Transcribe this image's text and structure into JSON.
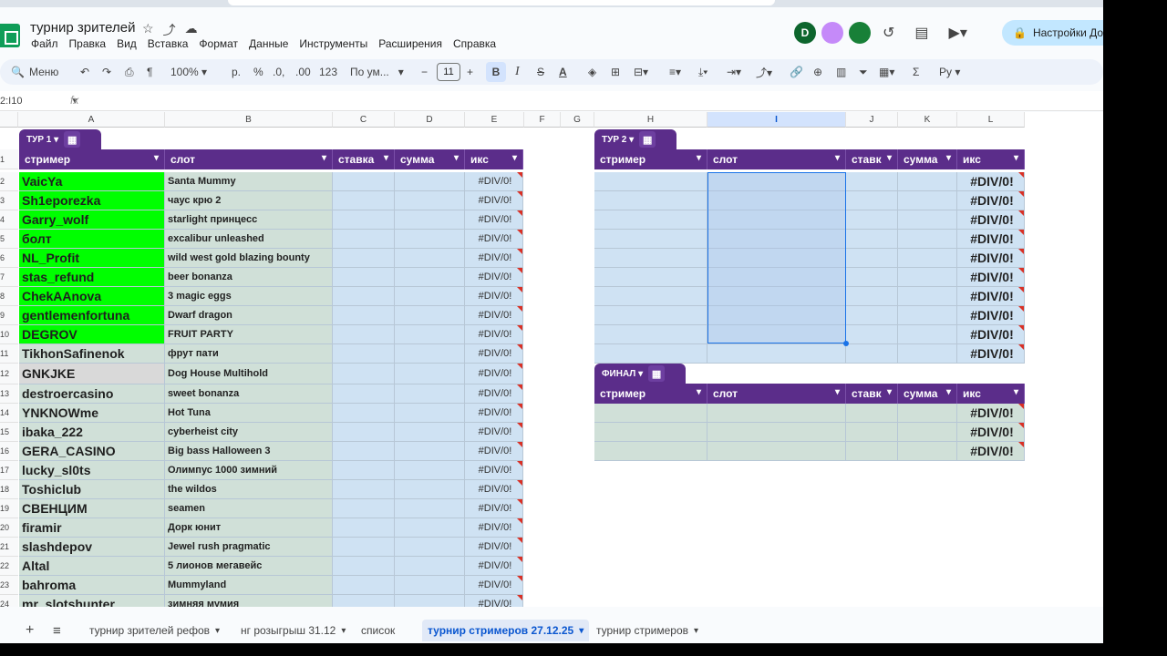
{
  "doc": {
    "title": "турнир зрителей"
  },
  "menu": [
    "Файл",
    "Правка",
    "Вид",
    "Вставка",
    "Формат",
    "Данные",
    "Инструменты",
    "Расширения",
    "Справка"
  ],
  "avatars": [
    {
      "letter": "D",
      "color": "#0d652d"
    },
    {
      "letter": "",
      "color": "#c58af9"
    },
    {
      "letter": "",
      "color": "#188038"
    }
  ],
  "share_label": "Настройки Дос",
  "toolbar": {
    "menu_search": "Меню",
    "zoom": "100%",
    "currency": "р.",
    "percent": "%",
    "dec_minus": ".0,",
    "dec_plus": ".00",
    "numfmt": "123",
    "font": "По ум...",
    "font_size": "11",
    "bold": "B",
    "italic": "I",
    "strike": "S",
    "textcolor": "A",
    "sum": "Σ",
    "input_lang": "Ру"
  },
  "namebox": "2:I10",
  "fx": "fx",
  "columns": [
    "A",
    "B",
    "C",
    "D",
    "E",
    "F",
    "G",
    "H",
    "I",
    "J",
    "K",
    "L"
  ],
  "tour1": {
    "tab_label": "ТУР 1",
    "headers": [
      "стример",
      "слот",
      "ставка",
      "сумма",
      "икс"
    ],
    "rows": [
      {
        "num": "2",
        "streamer": "VaicYa",
        "slot": "Santa Mummy",
        "x": "#DIV/0!",
        "hl": "green"
      },
      {
        "num": "3",
        "streamer": "Sh1eporezka",
        "slot": "чаус крю 2",
        "x": "#DIV/0!",
        "hl": "green"
      },
      {
        "num": "4",
        "streamer": "Garry_wolf",
        "slot": "starlight принцесс",
        "x": "#DIV/0!",
        "hl": "green"
      },
      {
        "num": "5",
        "streamer": "болт",
        "slot": "excalibur unleashed",
        "x": "#DIV/0!",
        "hl": "green"
      },
      {
        "num": "6",
        "streamer": "NL_Profit",
        "slot": "wild west gold blazing bounty",
        "x": "#DIV/0!",
        "hl": "green"
      },
      {
        "num": "7",
        "streamer": "stas_refund",
        "slot": "beer bonanza",
        "x": "#DIV/0!",
        "hl": "green"
      },
      {
        "num": "8",
        "streamer": "ChekAAnova",
        "slot": "3 magic eggs",
        "x": "#DIV/0!",
        "hl": "green"
      },
      {
        "num": "9",
        "streamer": "gentlemenfortuna",
        "slot": "Dwarf dragon",
        "x": "#DIV/0!",
        "hl": "green"
      },
      {
        "num": "10",
        "streamer": "DEGROV",
        "slot": "FRUIT PARTY",
        "x": "#DIV/0!",
        "hl": "green"
      },
      {
        "num": "11",
        "streamer": "TikhonSafinenok",
        "slot": "фрут пати",
        "x": "#DIV/0!",
        "hl": ""
      },
      {
        "num": "12",
        "streamer": "GNKJKE",
        "slot": "Dog House Multihold",
        "x": "#DIV/0!",
        "hl": "grey"
      },
      {
        "num": "13",
        "streamer": "destroercasino",
        "slot": "sweet bonanza",
        "x": "#DIV/0!",
        "hl": ""
      },
      {
        "num": "14",
        "streamer": "YNKNOWme",
        "slot": "Hot Tuna",
        "x": "#DIV/0!",
        "hl": ""
      },
      {
        "num": "15",
        "streamer": "ibaka_222",
        "slot": "cyberheist city",
        "x": "#DIV/0!",
        "hl": ""
      },
      {
        "num": "16",
        "streamer": "GERA_CASINO",
        "slot": "Big bass Halloween 3",
        "x": "#DIV/0!",
        "hl": ""
      },
      {
        "num": "17",
        "streamer": "lucky_sl0ts",
        "slot": "Олимпус 1000 зимний",
        "x": "#DIV/0!",
        "hl": ""
      },
      {
        "num": "18",
        "streamer": "Toshiclub",
        "slot": "the wildos",
        "x": "#DIV/0!",
        "hl": ""
      },
      {
        "num": "19",
        "streamer": "СВЕНЦИМ",
        "slot": "seamen",
        "x": "#DIV/0!",
        "hl": ""
      },
      {
        "num": "20",
        "streamer": "firamir",
        "slot": "Дорк юнит",
        "x": "#DIV/0!",
        "hl": ""
      },
      {
        "num": "21",
        "streamer": "slashdepov",
        "slot": "Jewel rush pragmatic",
        "x": "#DIV/0!",
        "hl": ""
      },
      {
        "num": "22",
        "streamer": "Altal",
        "slot": "5 лионов мегавейс",
        "x": "#DIV/0!",
        "hl": ""
      },
      {
        "num": "23",
        "streamer": "bahroma",
        "slot": "Mummyland",
        "x": "#DIV/0!",
        "hl": ""
      },
      {
        "num": "24",
        "streamer": "mr_slotshunter",
        "slot": "зимняя мумия",
        "x": "#DIV/0!",
        "hl": ""
      }
    ]
  },
  "tour2": {
    "tab_label": "ТУР 2",
    "headers": [
      "стример",
      "слот",
      "ставк",
      "сумма",
      "икс"
    ],
    "x_values": [
      "#DIV/0!",
      "#DIV/0!",
      "#DIV/0!",
      "#DIV/0!",
      "#DIV/0!",
      "#DIV/0!",
      "#DIV/0!",
      "#DIV/0!",
      "#DIV/0!",
      "#DIV/0!"
    ]
  },
  "final": {
    "tab_label": "ФИНАЛ",
    "headers": [
      "стример",
      "слот",
      "ставк",
      "сумма",
      "икс"
    ],
    "x_values": [
      "#DIV/0!",
      "#DIV/0!",
      "#DIV/0!"
    ]
  },
  "sheets": [
    {
      "label": "турнир зрителей рефов",
      "active": false
    },
    {
      "label": "нг розыгрыш 31.12",
      "active": false
    },
    {
      "label": "список",
      "active": false
    },
    {
      "label": "турнир стримеров 27.12.25",
      "active": true
    },
    {
      "label": "турнир стримеров",
      "active": false
    }
  ]
}
